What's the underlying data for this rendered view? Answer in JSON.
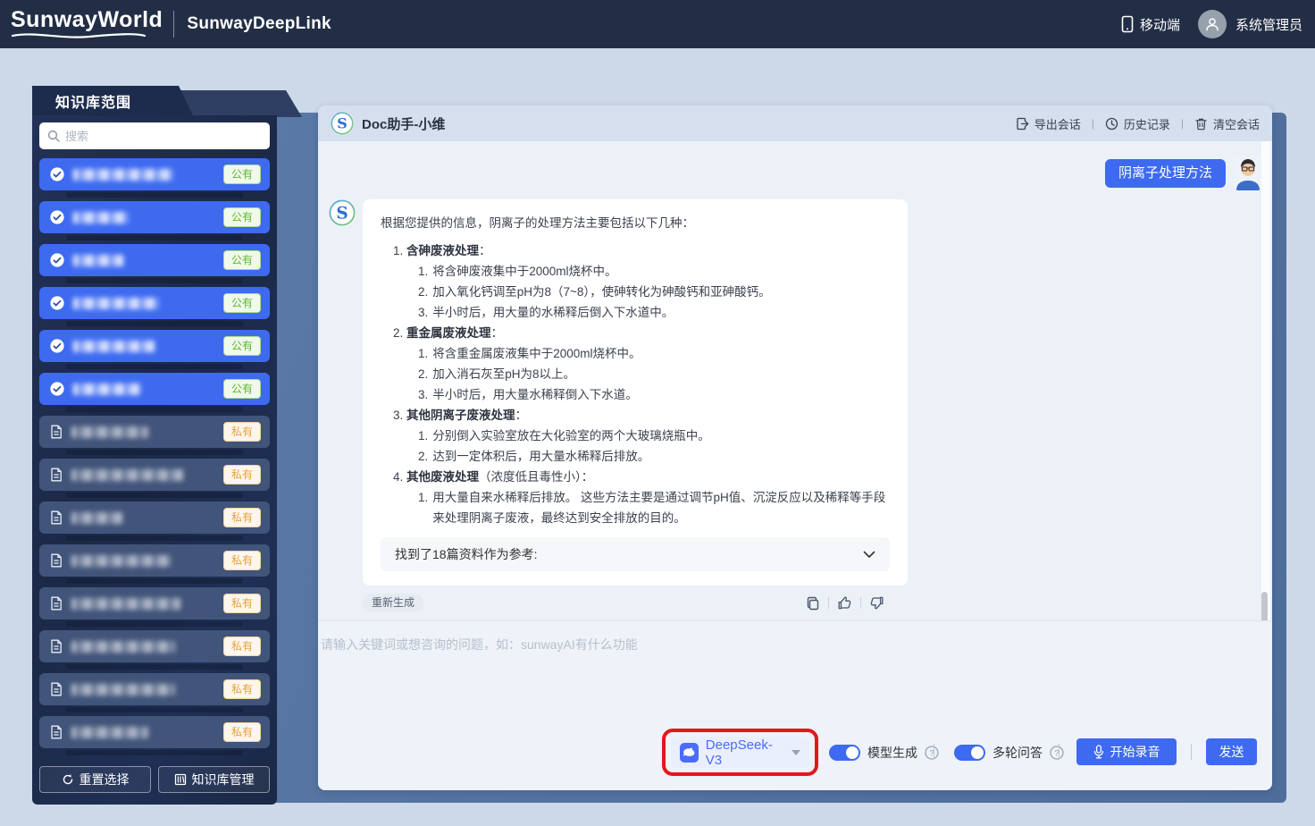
{
  "navbar": {
    "logo": "SunwayWorld",
    "product": "SunwayDeepLink",
    "mobile": "移动端",
    "admin": "系统管理员"
  },
  "sidebar": {
    "title": "知识库范围",
    "search_placeholder": "搜索",
    "items": [
      {
        "access": "公有",
        "type": "public",
        "selected": true,
        "blur_width": 112
      },
      {
        "access": "公有",
        "type": "public",
        "selected": true,
        "blur_width": 62
      },
      {
        "access": "公有",
        "type": "public",
        "selected": true,
        "blur_width": 56
      },
      {
        "access": "公有",
        "type": "public",
        "selected": true,
        "blur_width": 96
      },
      {
        "access": "公有",
        "type": "public",
        "selected": true,
        "blur_width": 92
      },
      {
        "access": "公有",
        "type": "public",
        "selected": true,
        "blur_width": 76
      },
      {
        "access": "私有",
        "type": "private",
        "selected": false,
        "blur_width": 86
      },
      {
        "access": "私有",
        "type": "private",
        "selected": false,
        "blur_width": 126
      },
      {
        "access": "私有",
        "type": "private",
        "selected": false,
        "blur_width": 58
      },
      {
        "access": "私有",
        "type": "private",
        "selected": false,
        "blur_width": 112
      },
      {
        "access": "私有",
        "type": "private",
        "selected": false,
        "blur_width": 122
      },
      {
        "access": "私有",
        "type": "private",
        "selected": false,
        "blur_width": 116
      },
      {
        "access": "私有",
        "type": "private",
        "selected": false,
        "blur_width": 116
      },
      {
        "access": "私有",
        "type": "private",
        "selected": false,
        "blur_width": 86
      }
    ],
    "reset": "重置选择",
    "manage": "知识库管理"
  },
  "chat": {
    "title": "Doc助手-小维",
    "actions": [
      {
        "label": "导出会话",
        "icon": "export-icon"
      },
      {
        "label": "历史记录",
        "icon": "history-icon"
      },
      {
        "label": "清空会话",
        "icon": "trash-icon"
      }
    ],
    "user_message": "阴离子处理方法",
    "answer": {
      "intro": "根据您提供的信息，阴离子的处理方法主要包括以下几种：",
      "sections": [
        {
          "title": "含砷废液处理",
          "suffix": "：",
          "steps": [
            "将含砷废液集中于2000ml烧杯中。",
            "加入氧化钙调至pH为8（7~8），使砷转化为砷酸钙和亚砷酸钙。",
            "半小时后，用大量的水稀释后倒入下水道中。"
          ]
        },
        {
          "title": "重金属废液处理",
          "suffix": "：",
          "steps": [
            "将含重金属废液集中于2000ml烧杯中。",
            "加入消石灰至pH为8以上。",
            "半小时后，用大量水稀释倒入下水道。"
          ]
        },
        {
          "title": "其他阴离子废液处理",
          "suffix": "：",
          "steps": [
            "分别倒入实验室放在大化验室的两个大玻璃烧瓶中。",
            "达到一定体积后，用大量水稀释后排放。"
          ]
        },
        {
          "title": "其他废液处理",
          "suffix": "（浓度低且毒性小）：",
          "steps": [
            "用大量自来水稀释后排放。 这些方法主要是通过调节pH值、沉淀反应以及稀释等手段来处理阴离子废液，最终达到安全排放的目的。"
          ]
        }
      ],
      "reference": "找到了18篇资料作为参考:"
    },
    "regenerate": "重新生成",
    "input_placeholder": "请输入关键词或想咨询的问题，如：sunwayAI有什么功能",
    "model": {
      "name": "DeepSeek-V3"
    },
    "toggles": [
      {
        "label": "模型生成",
        "on": true
      },
      {
        "label": "多轮问答",
        "on": true
      }
    ],
    "record": "开始录音",
    "send": "发送"
  },
  "colors": {
    "accent": "#3e6af0",
    "annotation_red": "#e0181c",
    "public_badge_green": "#5fb832",
    "private_badge_orange": "#e6a23c",
    "navbar_bg": "#222e45",
    "sidebar_bg": "#1d2b4c"
  }
}
